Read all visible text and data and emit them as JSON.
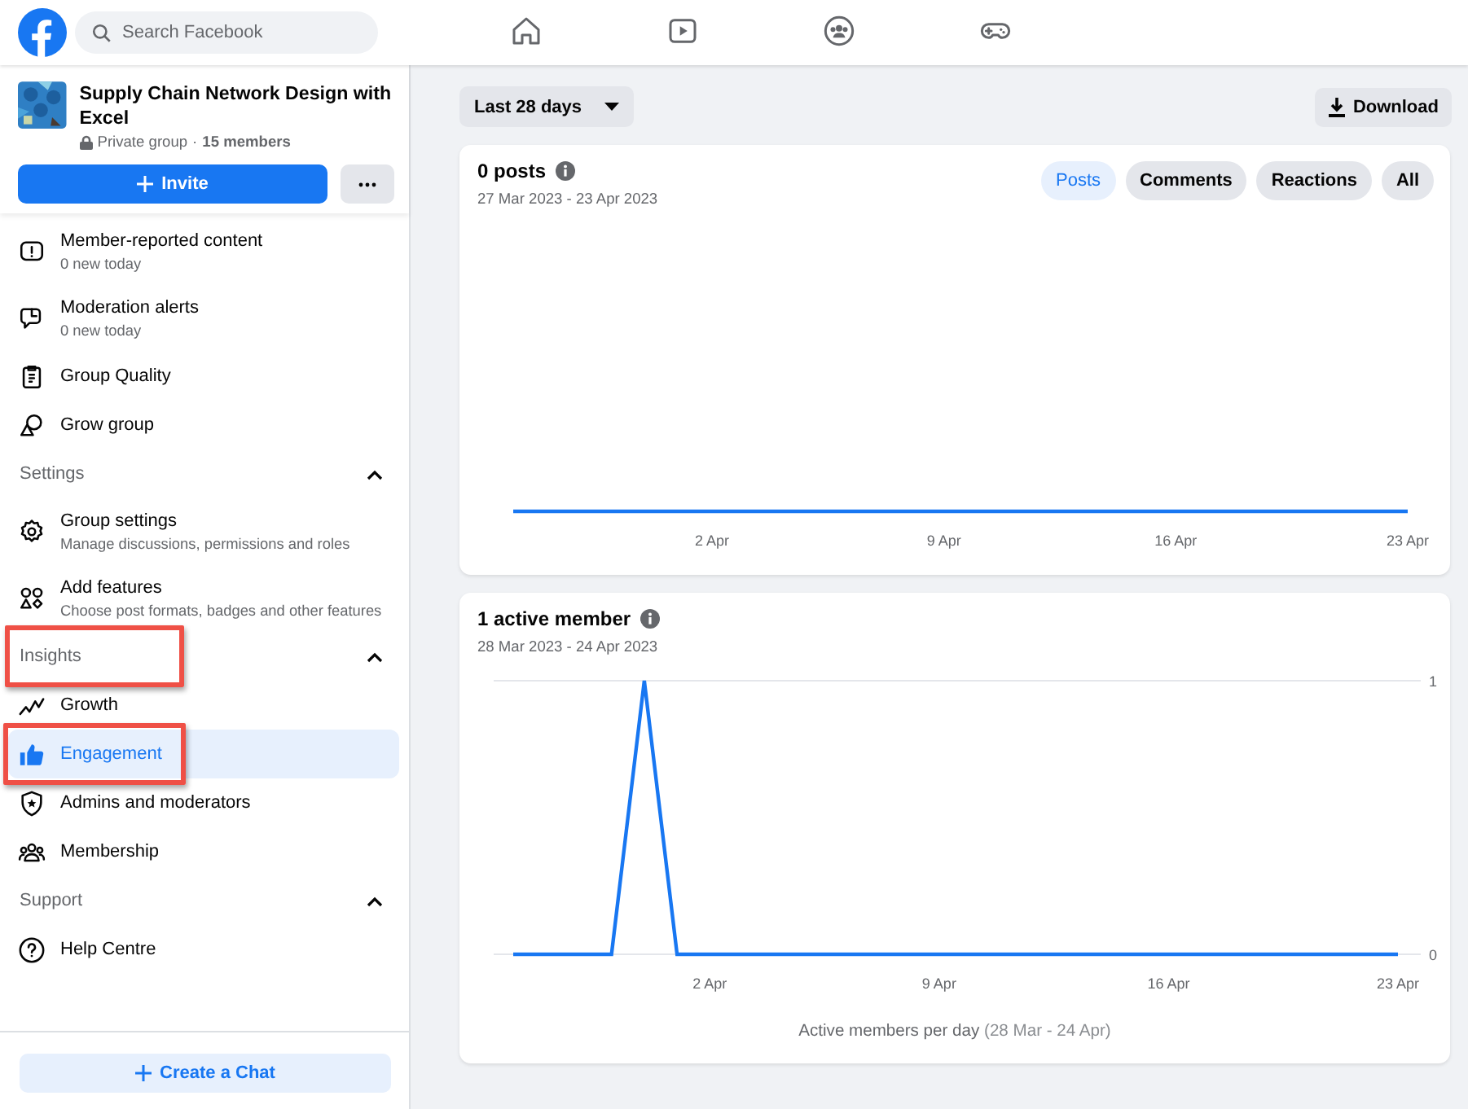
{
  "topbar": {
    "search": {
      "placeholder": "Search Facebook"
    },
    "tabs": [
      {
        "selected": false
      },
      {
        "selected": false
      },
      {
        "selected": false
      },
      {
        "selected": false
      }
    ]
  },
  "sidebar": {
    "group": {
      "name": "Supply Chain Network Design with Excel",
      "privacy": "Private group",
      "separator": "·",
      "members": "15 members"
    },
    "invite_button": "Invite",
    "nav": [
      {
        "kind": "item",
        "label": "Member-reported content",
        "subtitle": "0 new today",
        "selected": false,
        "highlighted": false
      },
      {
        "kind": "item",
        "label": "Moderation alerts",
        "subtitle": "0 new today",
        "selected": false,
        "highlighted": false
      },
      {
        "kind": "item",
        "label": "Group Quality",
        "selected": false,
        "highlighted": false
      },
      {
        "kind": "item",
        "label": "Grow group",
        "selected": false,
        "highlighted": false
      },
      {
        "kind": "section",
        "label": "Settings",
        "expanded": true,
        "highlighted": false
      },
      {
        "kind": "item",
        "label": "Group settings",
        "subtitle": "Manage discussions, permissions and roles",
        "selected": false,
        "highlighted": false
      },
      {
        "kind": "item",
        "label": "Add features",
        "subtitle": "Choose post formats, badges and other features",
        "selected": false,
        "highlighted": false
      },
      {
        "kind": "section",
        "label": "Insights",
        "expanded": true,
        "highlighted": true
      },
      {
        "kind": "item",
        "label": "Growth",
        "selected": false,
        "highlighted": false
      },
      {
        "kind": "item",
        "label": "Engagement",
        "selected": true,
        "highlighted": true
      },
      {
        "kind": "item",
        "label": "Admins and moderators",
        "selected": false,
        "highlighted": false
      },
      {
        "kind": "item",
        "label": "Membership",
        "selected": false,
        "highlighted": false
      },
      {
        "kind": "section",
        "label": "Support",
        "expanded": true,
        "highlighted": false
      },
      {
        "kind": "item",
        "label": "Help Centre",
        "selected": false,
        "highlighted": false
      }
    ],
    "chat_button": "Create a Chat"
  },
  "main": {
    "date_filter": "Last 28 days",
    "download_button": "Download",
    "cards": [
      {
        "title": "0 posts",
        "date_range": "27 Mar 2023 - 23 Apr 2023",
        "filters": [
          {
            "label": "Posts",
            "selected": true
          },
          {
            "label": "Comments",
            "selected": false
          },
          {
            "label": "Reactions",
            "selected": false
          },
          {
            "label": "All",
            "selected": false
          }
        ],
        "axis_labels": [
          "2 Apr",
          "9 Apr",
          "16 Apr",
          "23 Apr"
        ]
      },
      {
        "title": "1 active member",
        "date_range": "28 Mar 2023 - 24 Apr 2023",
        "caption": "Active members per day",
        "caption_range": "(28 Mar - 24 Apr)",
        "chart_data": {
          "type": "line",
          "categories": [
            null,
            null,
            null,
            null,
            null,
            null,
            "2 Apr",
            null,
            null,
            null,
            null,
            null,
            null,
            "9 Apr",
            null,
            null,
            null,
            null,
            null,
            null,
            "16 Apr",
            null,
            null,
            null,
            null,
            null,
            null,
            "23 Apr"
          ],
          "yticks": [
            0,
            1
          ],
          "ylim": [
            0,
            1
          ],
          "series": [
            {
              "color": "#1877f2",
              "values": [
                0,
                0,
                0,
                0,
                1,
                0,
                0,
                0,
                0,
                0,
                0,
                0,
                0,
                0,
                0,
                0,
                0,
                0,
                0,
                0,
                0,
                0,
                0,
                0,
                0,
                0,
                0,
                0
              ]
            }
          ]
        }
      }
    ]
  }
}
